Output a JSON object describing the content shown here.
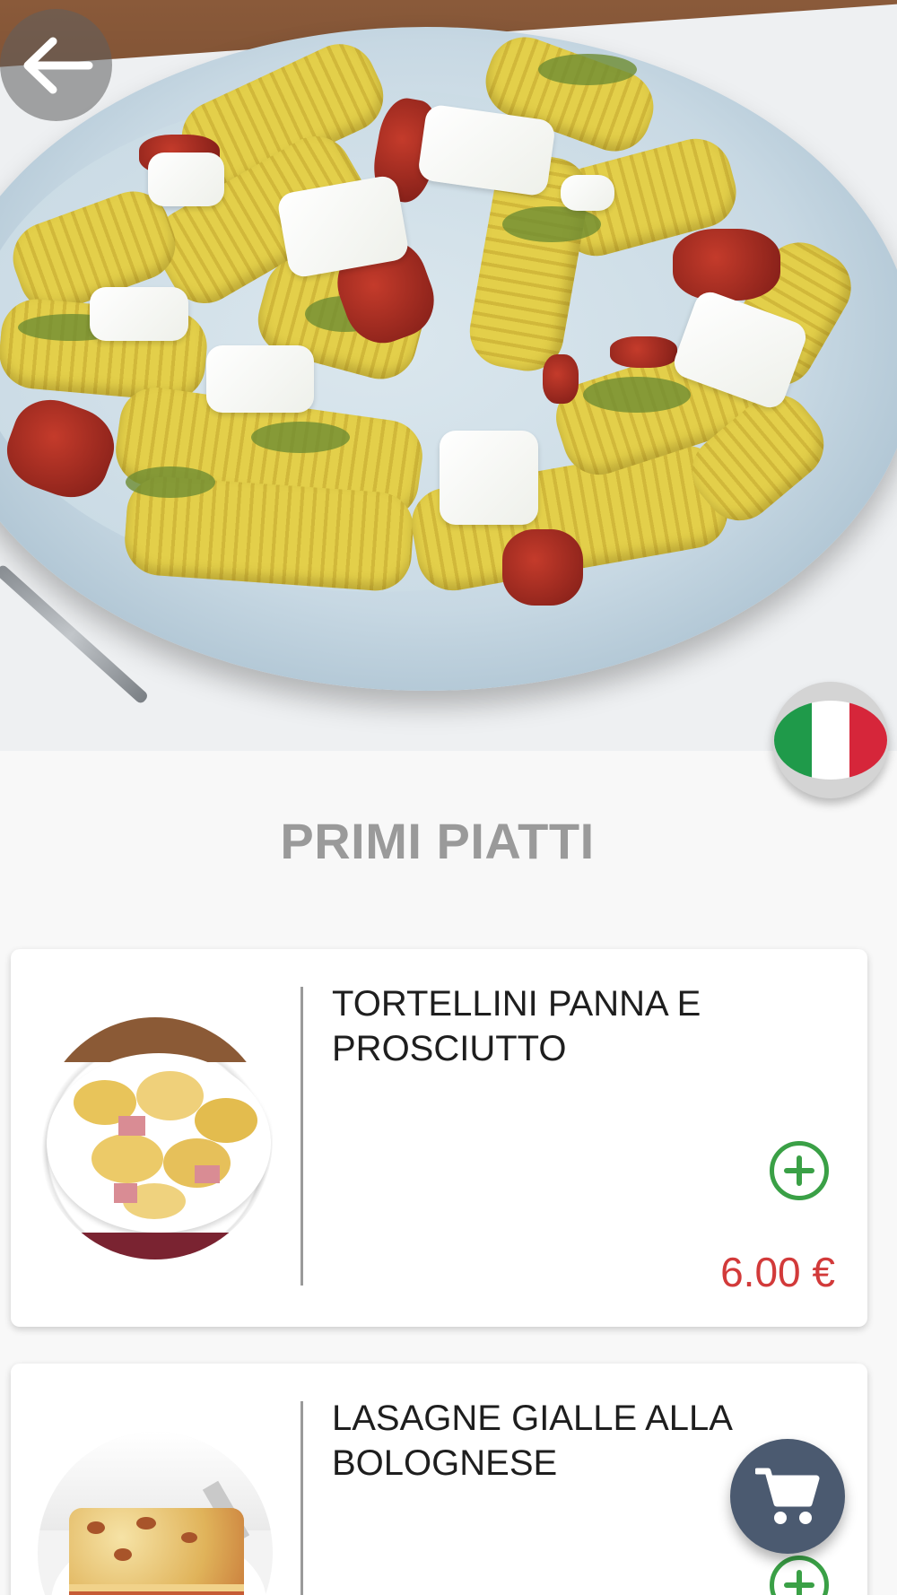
{
  "header": {
    "hero_image": "pasta-dish-photo",
    "back_icon": "arrow-left-icon",
    "language_flag": "italy-flag-icon"
  },
  "section": {
    "title": "PRIMI PIATTI"
  },
  "items": [
    {
      "title": "TORTELLINI PANNA E PROSCIUTTO",
      "price": "6.00 €",
      "image": "tortellini-photo"
    },
    {
      "title": "LASAGNE GIALLE ALLA BOLOGNESE",
      "price": "",
      "image": "lasagne-photo"
    }
  ],
  "cart": {
    "icon": "shopping-cart-icon"
  },
  "colors": {
    "price": "#d23a3a",
    "add_button": "#3aa046",
    "cart_button": "#4b5a70",
    "section_title": "#9a9a9a",
    "flag_green": "#1f9a4a",
    "flag_white": "#ffffff",
    "flag_red": "#d6263a"
  }
}
